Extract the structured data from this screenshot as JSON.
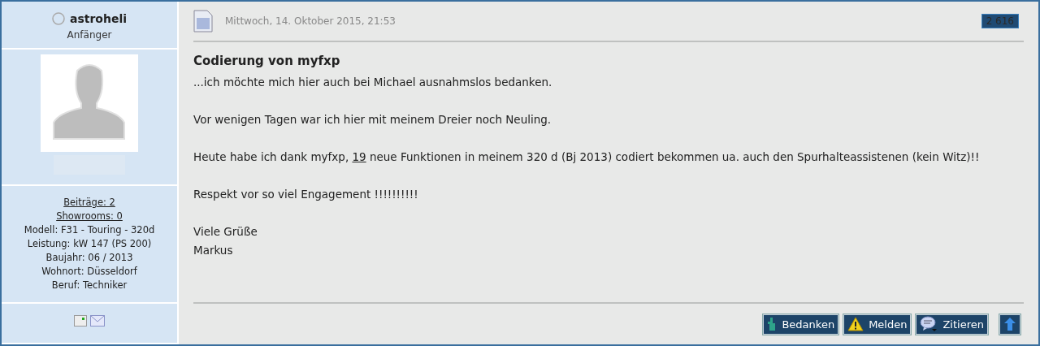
{
  "author": {
    "name": "astroheli",
    "online": false,
    "rank": "Anfänger",
    "stats": [
      {
        "kind": "link",
        "text": "Beiträge: 2"
      },
      {
        "kind": "link",
        "text": "Showrooms: 0"
      },
      {
        "kind": "text",
        "text": "Modell: F31 - Touring - 320d"
      },
      {
        "kind": "text",
        "text": "Leistung: kW 147 (PS 200)"
      },
      {
        "kind": "text",
        "text": "Baujahr: 06 / 2013"
      },
      {
        "kind": "text",
        "text": "Wohnort: Düsseldorf"
      },
      {
        "kind": "text",
        "text": "Beruf: Techniker"
      }
    ]
  },
  "post": {
    "date": "Mittwoch, 14. Oktober 2015, 21:53",
    "views": "2 616",
    "title": "Codierung von myfxp",
    "paragraphs": [
      {
        "lines": [
          {
            "parts": [
              {
                "text": "...ich möchte mich hier auch bei Michael ausnahmslos bedanken."
              }
            ]
          }
        ]
      },
      {
        "lines": [
          {
            "parts": [
              {
                "text": "Vor wenigen Tagen war ich hier mit meinem Dreier noch Neuling."
              }
            ]
          }
        ]
      },
      {
        "lines": [
          {
            "parts": [
              {
                "text": "Heute habe ich dank myfxp, "
              },
              {
                "text": "19",
                "link": true
              },
              {
                "text": " neue Funktionen in meinem 320 d (Bj 2013) codiert bekommen ua. auch den Spurhalteassistenen (kein Witz)!!"
              }
            ]
          }
        ]
      },
      {
        "lines": [
          {
            "parts": [
              {
                "text": "Respekt vor so viel Engagement !!!!!!!!!!"
              }
            ]
          }
        ]
      },
      {
        "lines": [
          {
            "parts": [
              {
                "text": "Viele Grüße"
              }
            ]
          },
          {
            "parts": [
              {
                "text": "Markus"
              }
            ]
          }
        ]
      }
    ],
    "buttons": [
      {
        "kind": "thanks",
        "label": "Bedanken"
      },
      {
        "kind": "report",
        "label": "Melden"
      },
      {
        "kind": "quote",
        "label": "Zitieren"
      },
      {
        "kind": "top"
      }
    ]
  }
}
